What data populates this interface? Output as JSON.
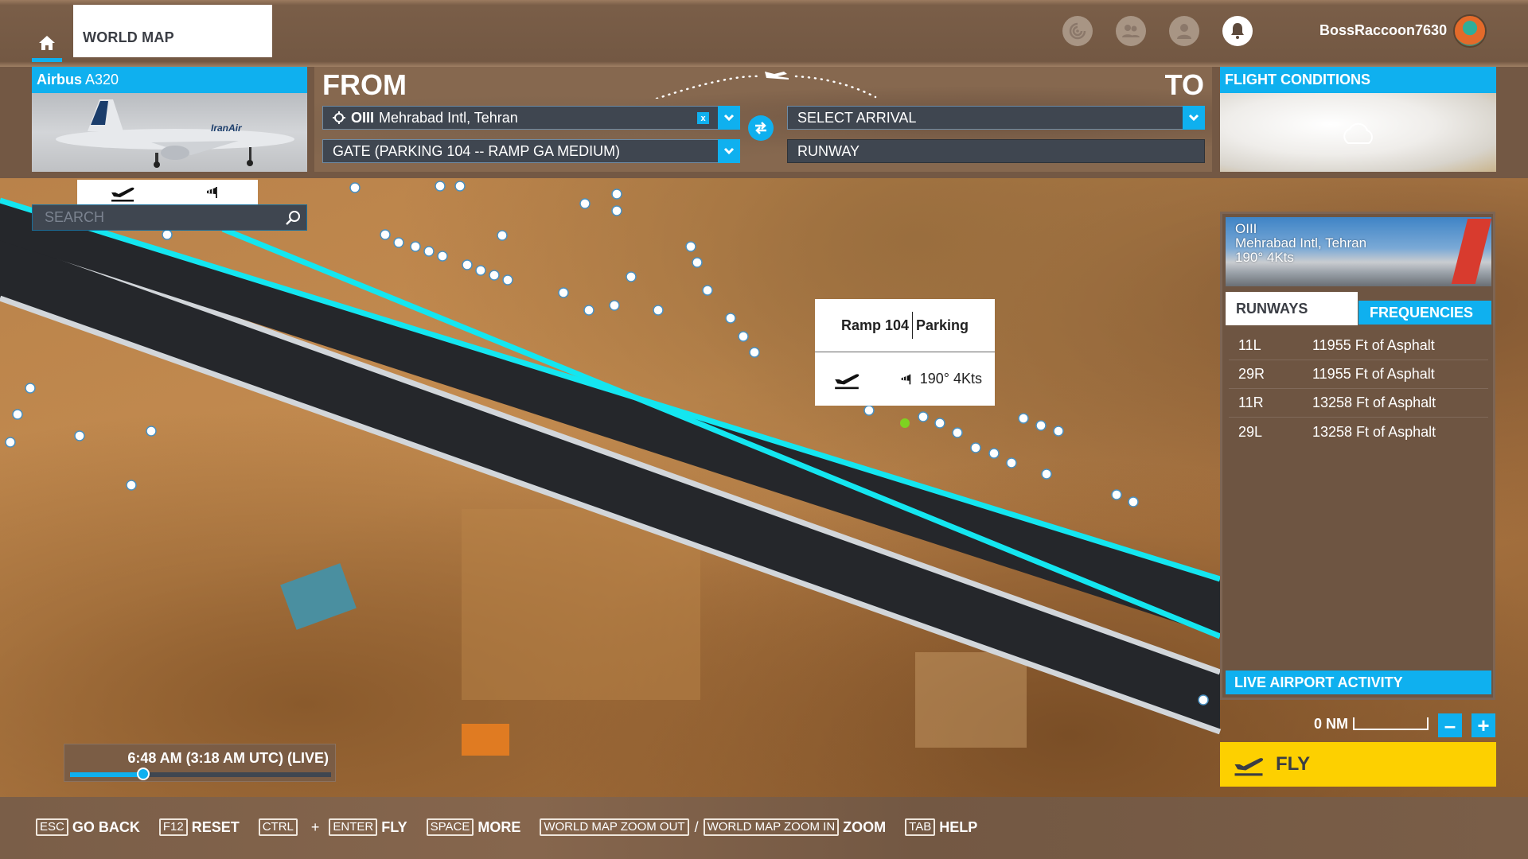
{
  "topbar": {
    "home_icon": "home-icon",
    "tab_label": "WORLD MAP",
    "icons": [
      "activity-icon",
      "friends-icon",
      "profile-icon",
      "notifications-bell-icon"
    ],
    "username": "BossRaccoon7630"
  },
  "aircraft": {
    "make": "Airbus",
    "model": "A320",
    "livery_text": "IranAir"
  },
  "route": {
    "from_label": "FROM",
    "to_label": "TO",
    "departure": {
      "icao": "OIII",
      "name": "Mehrabad Intl, Tehran",
      "clear_label": "x"
    },
    "departure_spot": "GATE (PARKING 104 -- RAMP GA MEDIUM)",
    "arrival": "SELECT ARRIVAL",
    "arrival_spot": "RUNWAY"
  },
  "flight_conditions": {
    "title": "FLIGHT CONDITIONS"
  },
  "map": {
    "search_placeholder": "SEARCH",
    "tabs": [
      "departure-icon",
      "windsock-icon"
    ],
    "colors": {
      "selected_runway": "#14e6f0",
      "other_runway": "#d2d6da",
      "runway_fill": "#25272b",
      "parking_dot": "#ffffff",
      "selected_parking": "#7ed321"
    }
  },
  "popup": {
    "location": "Ramp 104",
    "type": "Parking",
    "wind": "190° 4Kts"
  },
  "airport_panel": {
    "icao": "OIII",
    "name": "Mehrabad Intl, Tehran",
    "wind": "190° 4Kts",
    "tabs": [
      "RUNWAYS",
      "FREQUENCIES"
    ],
    "active_tab": "RUNWAYS",
    "runways": [
      {
        "id": "11L",
        "desc": "11955 Ft of Asphalt"
      },
      {
        "id": "29R",
        "desc": "11955 Ft of Asphalt"
      },
      {
        "id": "11R",
        "desc": "13258 Ft of Asphalt"
      },
      {
        "id": "29L",
        "desc": "13258 Ft of Asphalt"
      }
    ],
    "live_activity_label": "LIVE AIRPORT ACTIVITY"
  },
  "scale": {
    "label": "0 NM",
    "zoom_out": "–",
    "zoom_in": "+"
  },
  "fly_button": {
    "label": "FLY"
  },
  "time": {
    "label": "6:48 AM (3:18 AM UTC) (LIVE)",
    "progress_fraction": 0.28
  },
  "footer": {
    "hints": [
      {
        "keys": [
          "ESC"
        ],
        "action": "GO BACK"
      },
      {
        "keys": [
          "F12"
        ],
        "action": "RESET"
      },
      {
        "keys": [
          "CTRL",
          "ENTER"
        ],
        "joiner": "+",
        "action": "FLY"
      },
      {
        "keys": [
          "SPACE"
        ],
        "action": "MORE"
      },
      {
        "keys": [
          "WORLD MAP ZOOM OUT",
          "WORLD MAP ZOOM IN"
        ],
        "joiner": "/",
        "action": "ZOOM"
      },
      {
        "keys": [
          "TAB"
        ],
        "action": "HELP"
      }
    ]
  }
}
